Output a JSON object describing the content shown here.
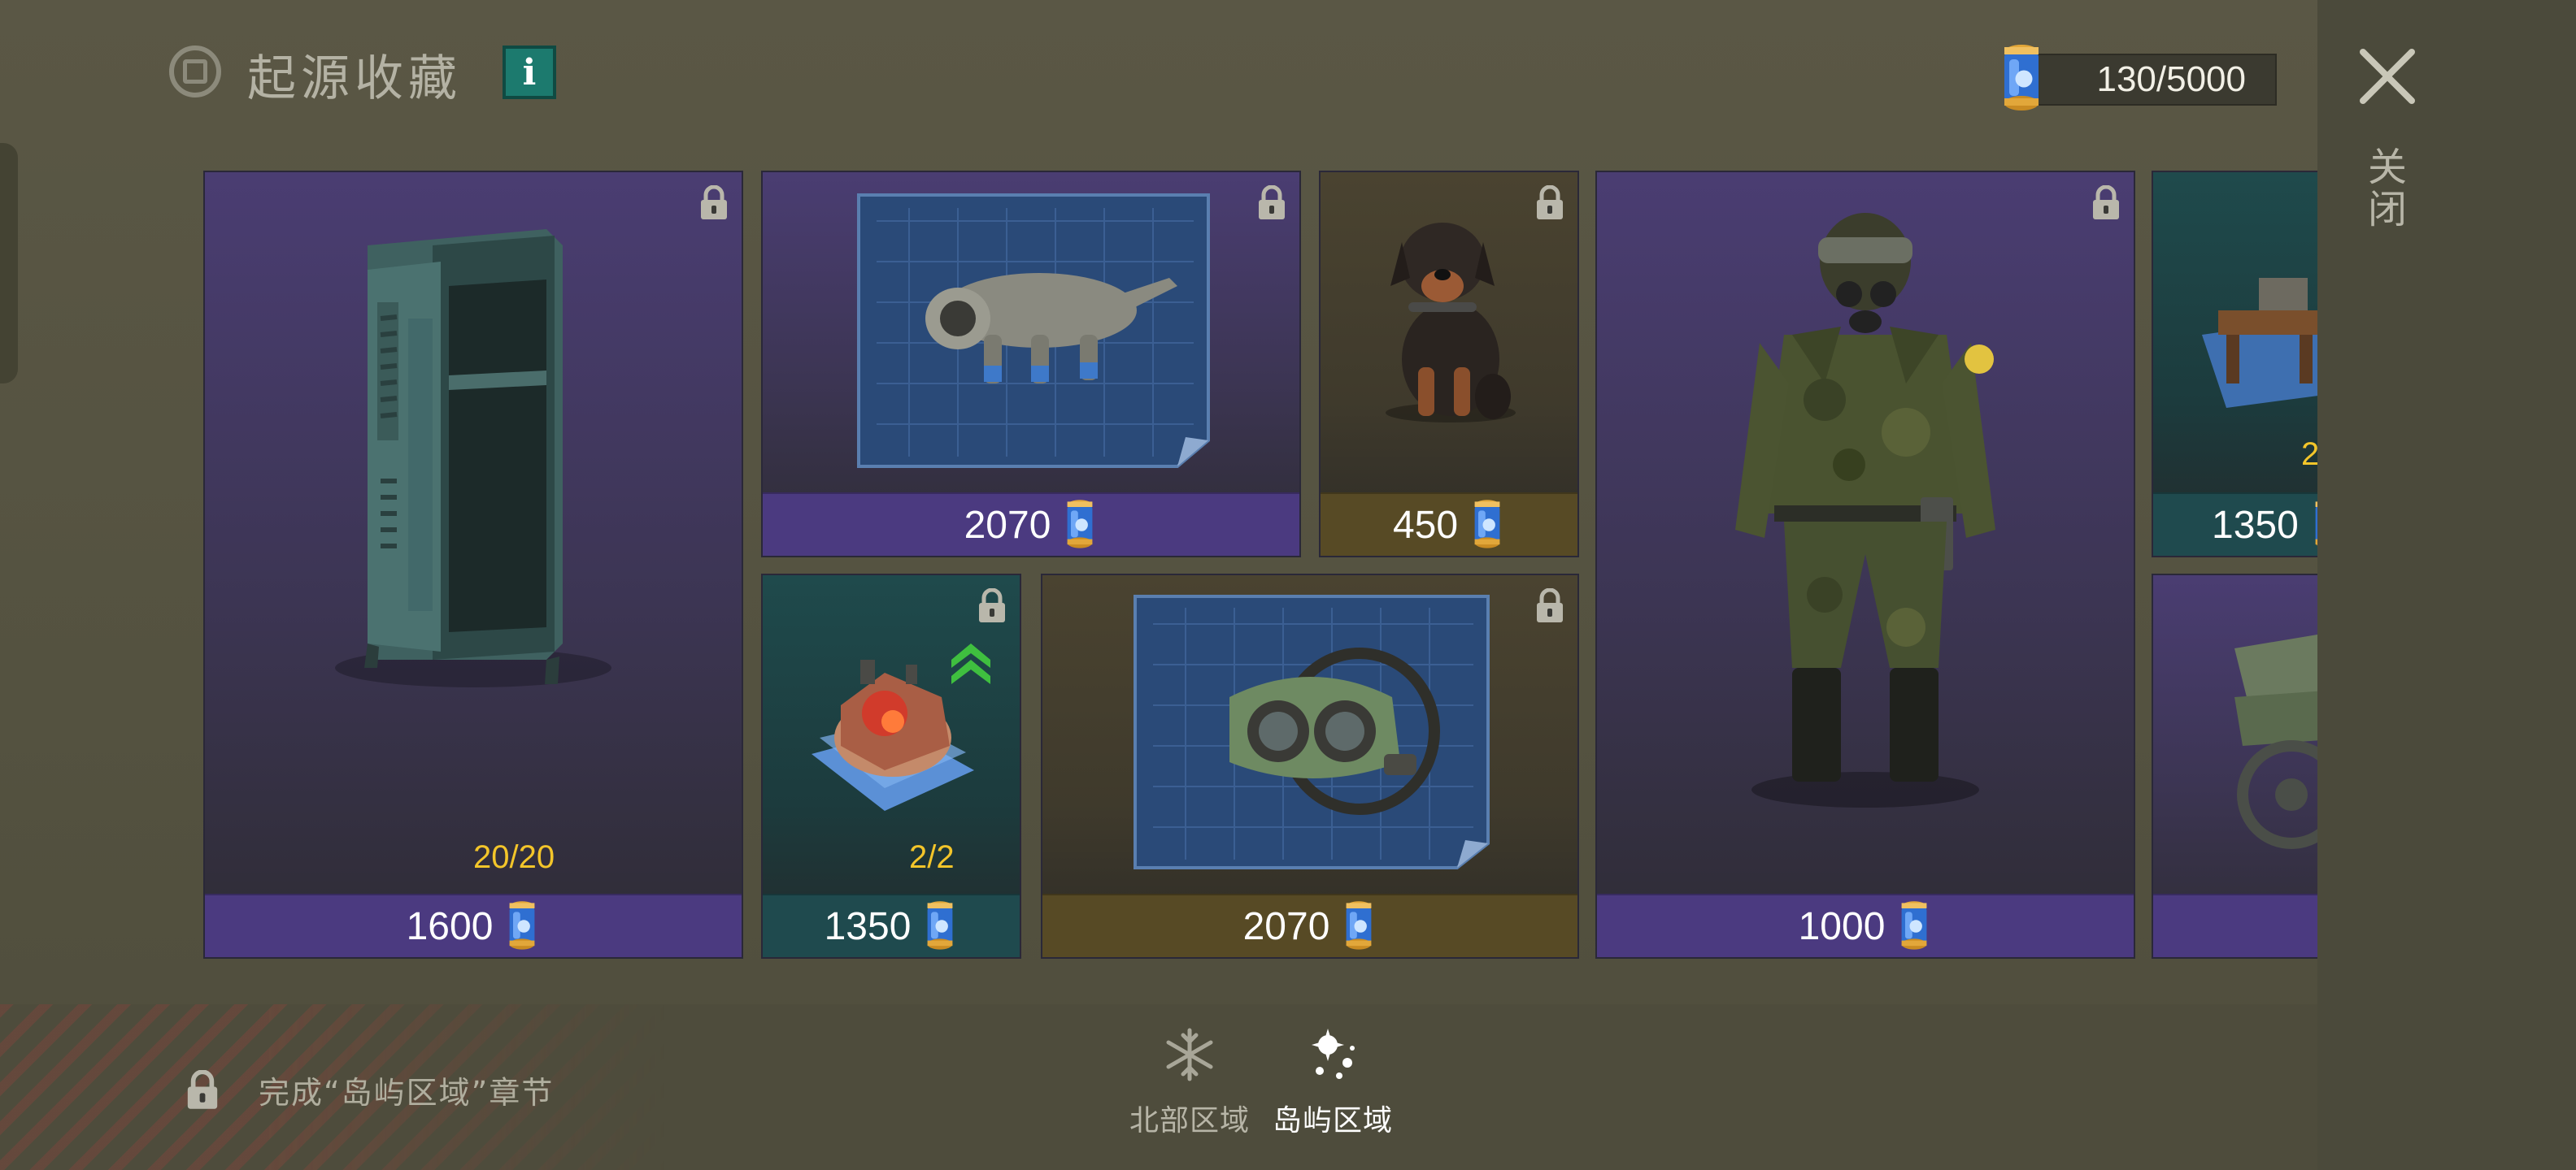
{
  "header": {
    "title": "起源收藏",
    "info_label": "i"
  },
  "currency": {
    "amount": "130/5000"
  },
  "close": {
    "label": "关闭"
  },
  "cards": [
    {
      "name": "locker",
      "price": "1600",
      "progress": "20/20",
      "theme": "purple",
      "locked": true
    },
    {
      "name": "dog-suit-blueprint",
      "price": "2070",
      "theme": "purple",
      "locked": true
    },
    {
      "name": "dog",
      "price": "450",
      "theme": "olive",
      "locked": true
    },
    {
      "name": "soldier-outfit",
      "price": "1000",
      "theme": "purple",
      "locked": true
    },
    {
      "name": "table-blueprint",
      "price": "1350",
      "progress": "2",
      "theme": "teal",
      "locked": true
    },
    {
      "name": "furnace-blueprint",
      "price": "1350",
      "progress": "2/2",
      "theme": "teal",
      "locked": true,
      "upgrade": true
    },
    {
      "name": "goggles-blueprint",
      "price": "2070",
      "theme": "olive",
      "locked": true
    },
    {
      "name": "vehicle",
      "theme": "purple"
    }
  ],
  "footer": {
    "unlock_hint": "完成“岛屿区域”章节",
    "regions": [
      {
        "label": "北部区域",
        "icon": "snowflake-icon",
        "active": false
      },
      {
        "label": "岛屿区域",
        "icon": "island-icon",
        "active": true
      }
    ]
  },
  "colors": {
    "background": "#55533f",
    "price_purple": "#4b3a80",
    "price_teal": "#1f4a4e",
    "price_olive": "#574a25",
    "progress_yellow": "#f3c52a",
    "info_teal": "#1c7a6e"
  }
}
